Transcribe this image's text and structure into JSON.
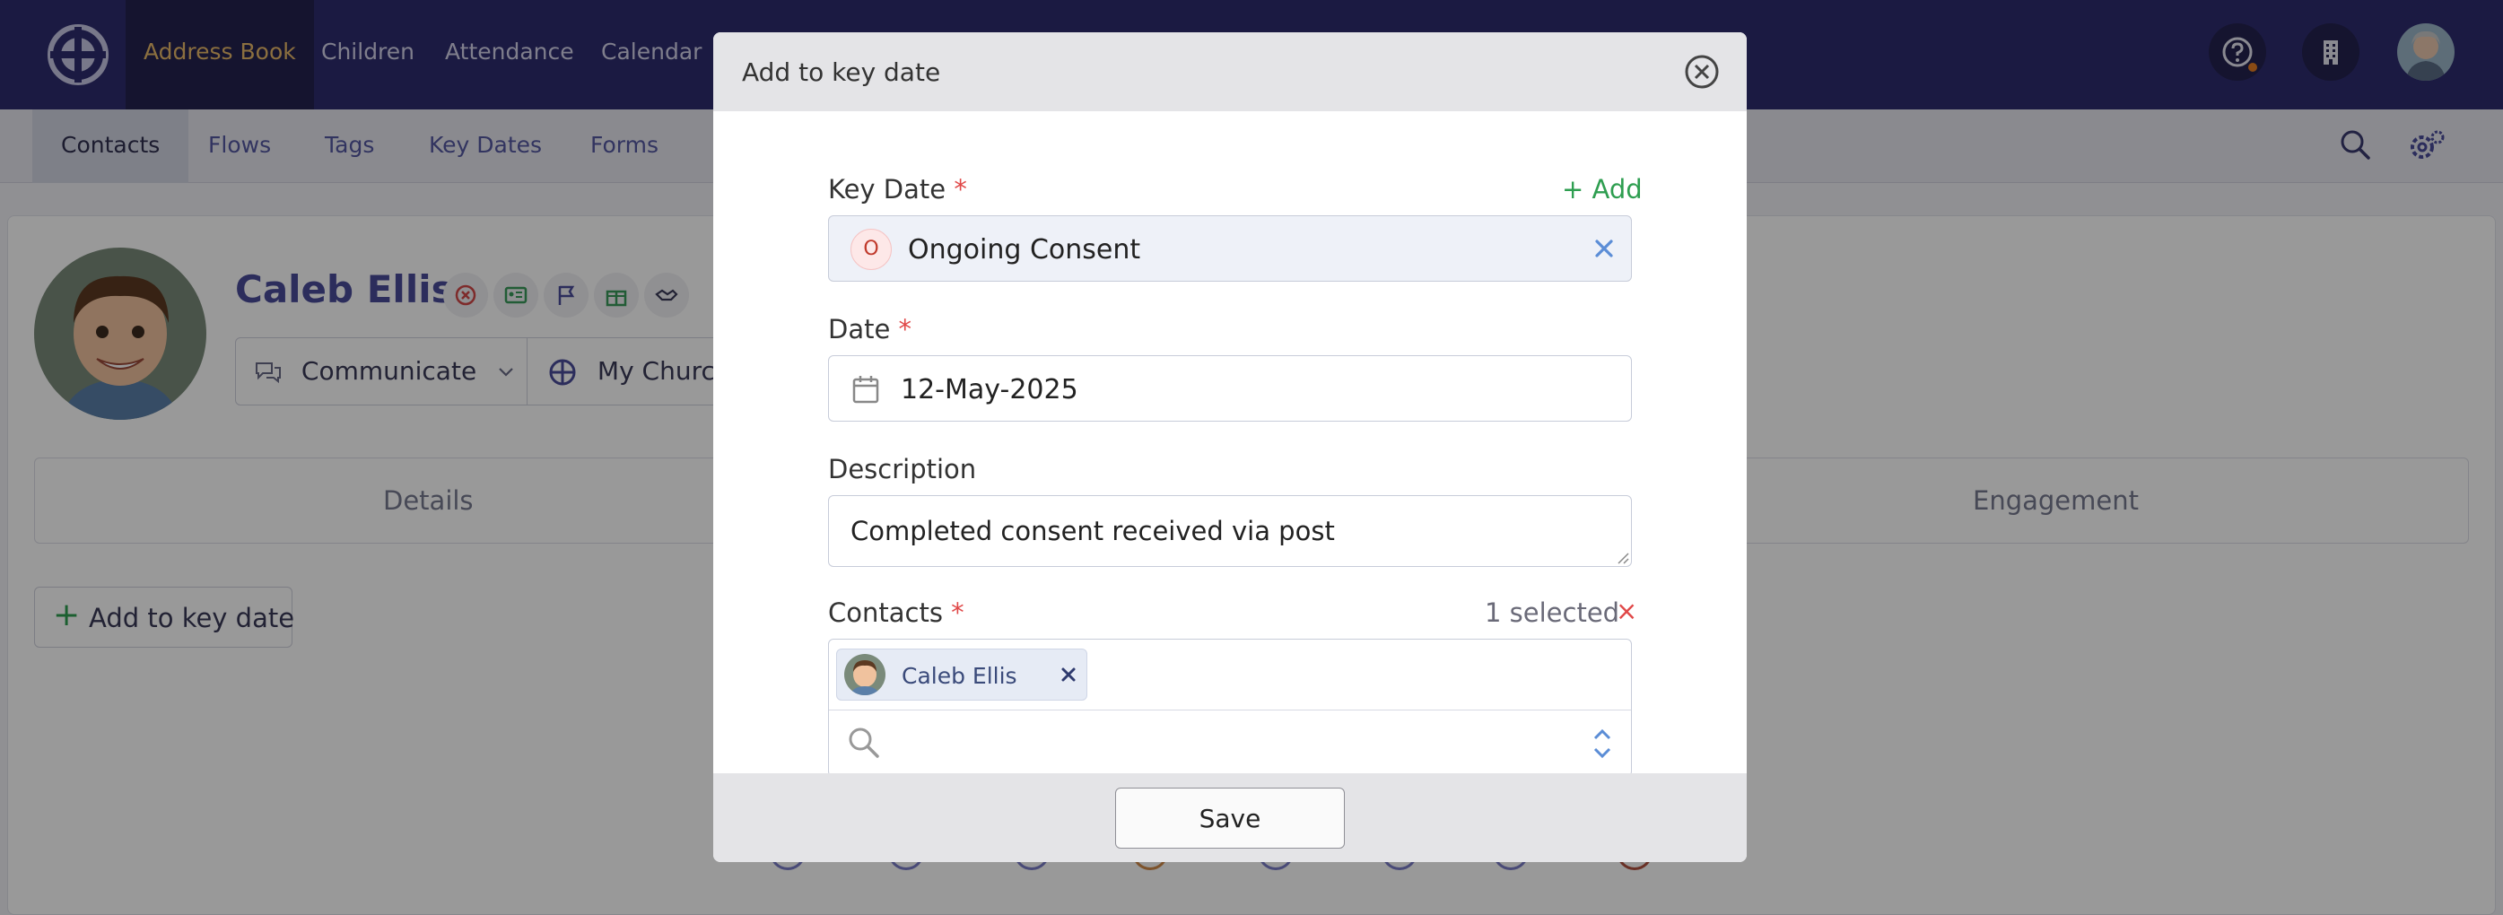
{
  "topnav": {
    "logo_icon": "church-cross-logo-icon",
    "items": [
      {
        "label": "Address Book",
        "active": true
      },
      {
        "label": "Children"
      },
      {
        "label": "Attendance"
      },
      {
        "label": "Calendar"
      }
    ],
    "icons": [
      "help-icon",
      "building-icon",
      "user-avatar"
    ]
  },
  "subnav": {
    "items": [
      {
        "label": "Contacts",
        "active": true
      },
      {
        "label": "Flows"
      },
      {
        "label": "Tags"
      },
      {
        "label": "Key Dates"
      },
      {
        "label": "Forms"
      }
    ],
    "icons": [
      "search-icon",
      "settings-icon"
    ]
  },
  "profile": {
    "name": "Caleb Ellis",
    "communicate_label": "Communicate",
    "church_label": "My Church",
    "tabs": [
      {
        "label": "Details"
      },
      {
        "label": "Engagement"
      }
    ],
    "add_key_date_label": "Add to key date"
  },
  "modal": {
    "title": "Add to key date",
    "key_date": {
      "label": "Key Date",
      "required_mark": "*",
      "add_link": "+ Add",
      "value": "Ongoing Consent",
      "badge": "O"
    },
    "date": {
      "label": "Date",
      "required_mark": "*",
      "value": "12-May-2025"
    },
    "description": {
      "label": "Description",
      "value": "Completed consent received via post"
    },
    "contacts": {
      "label": "Contacts",
      "required_mark": "*",
      "selected_count": "1 selected",
      "clear_label": "×",
      "chips": [
        {
          "name": "Caleb Ellis"
        }
      ],
      "search_placeholder": ""
    },
    "save_label": "Save"
  },
  "colors": {
    "nav_bg": "#2e2c6e",
    "nav_active_text": "#e8b96a",
    "accent": "#4a4c9a",
    "required": "#e04848",
    "add_link": "#2e9e50",
    "clear_x": "#5b8dd6"
  }
}
